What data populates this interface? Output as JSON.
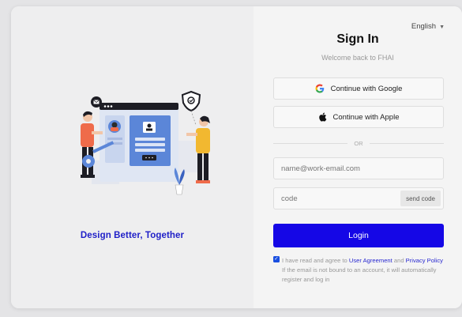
{
  "left": {
    "tagline": "Design Better, Together"
  },
  "header": {
    "language": "English",
    "title": "Sign In",
    "subtitle": "Welcome back to FHAI"
  },
  "social": {
    "google_label": "Continue with Google",
    "apple_label": "Continue with Apple",
    "divider": "OR"
  },
  "form": {
    "email_placeholder": "name@work-email.com",
    "code_placeholder": "code",
    "send_code": "send code",
    "login": "Login"
  },
  "agreement": {
    "checked": true,
    "prefix": "I have read and agree to",
    "user_agreement": "User Agreement",
    "and": "and",
    "privacy_policy": "Privacy Policy",
    "note": "If the email is not bound to an account, it will automatically register and log in"
  },
  "colors": {
    "primary": "#1507e6",
    "link": "#2a2ad0",
    "illustration_blue": "#5b86d8",
    "illustration_orange": "#ef6b4a",
    "illustration_yellow": "#f2b830"
  },
  "icons": {
    "google": "google-logo-icon",
    "apple": "apple-logo-icon",
    "language_caret": "caret-down-icon"
  }
}
